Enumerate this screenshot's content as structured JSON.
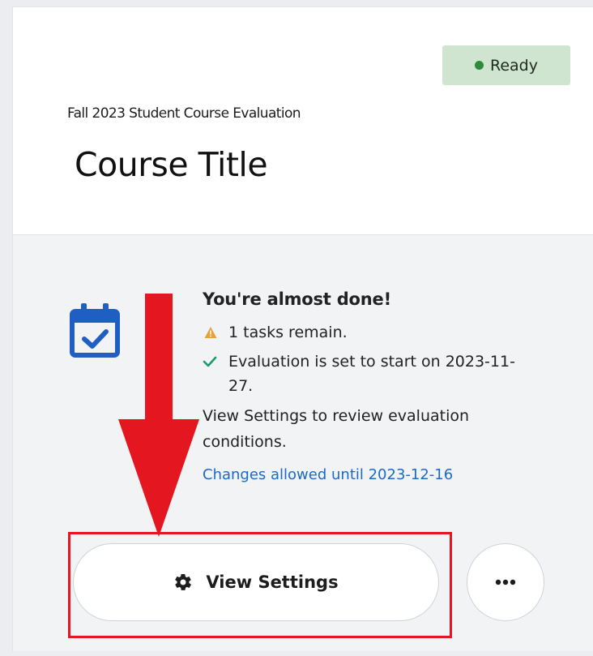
{
  "status": {
    "label": "Ready",
    "dot_color": "#2e8b3a",
    "badge_color": "#cfe5cf"
  },
  "evaluation": {
    "name": "Fall 2023 Student Course Evaluation",
    "course_title": "Course Title"
  },
  "progress": {
    "heading": "You're almost done!",
    "tasks_remaining": "1 tasks remain.",
    "start_notice": "Evaluation is set to start on 2023-11-27.",
    "settings_hint": "View Settings to review evaluation conditions.",
    "changes_link": "Changes allowed until 2023-12-16"
  },
  "actions": {
    "view_settings_label": "View Settings",
    "more_icon": "more-horizontal-icon",
    "settings_icon": "gear-icon"
  },
  "annotation": {
    "color": "#e4161f"
  },
  "icons": {
    "calendar": "calendar-check-icon",
    "warning": "warning-icon",
    "check": "check-icon"
  }
}
